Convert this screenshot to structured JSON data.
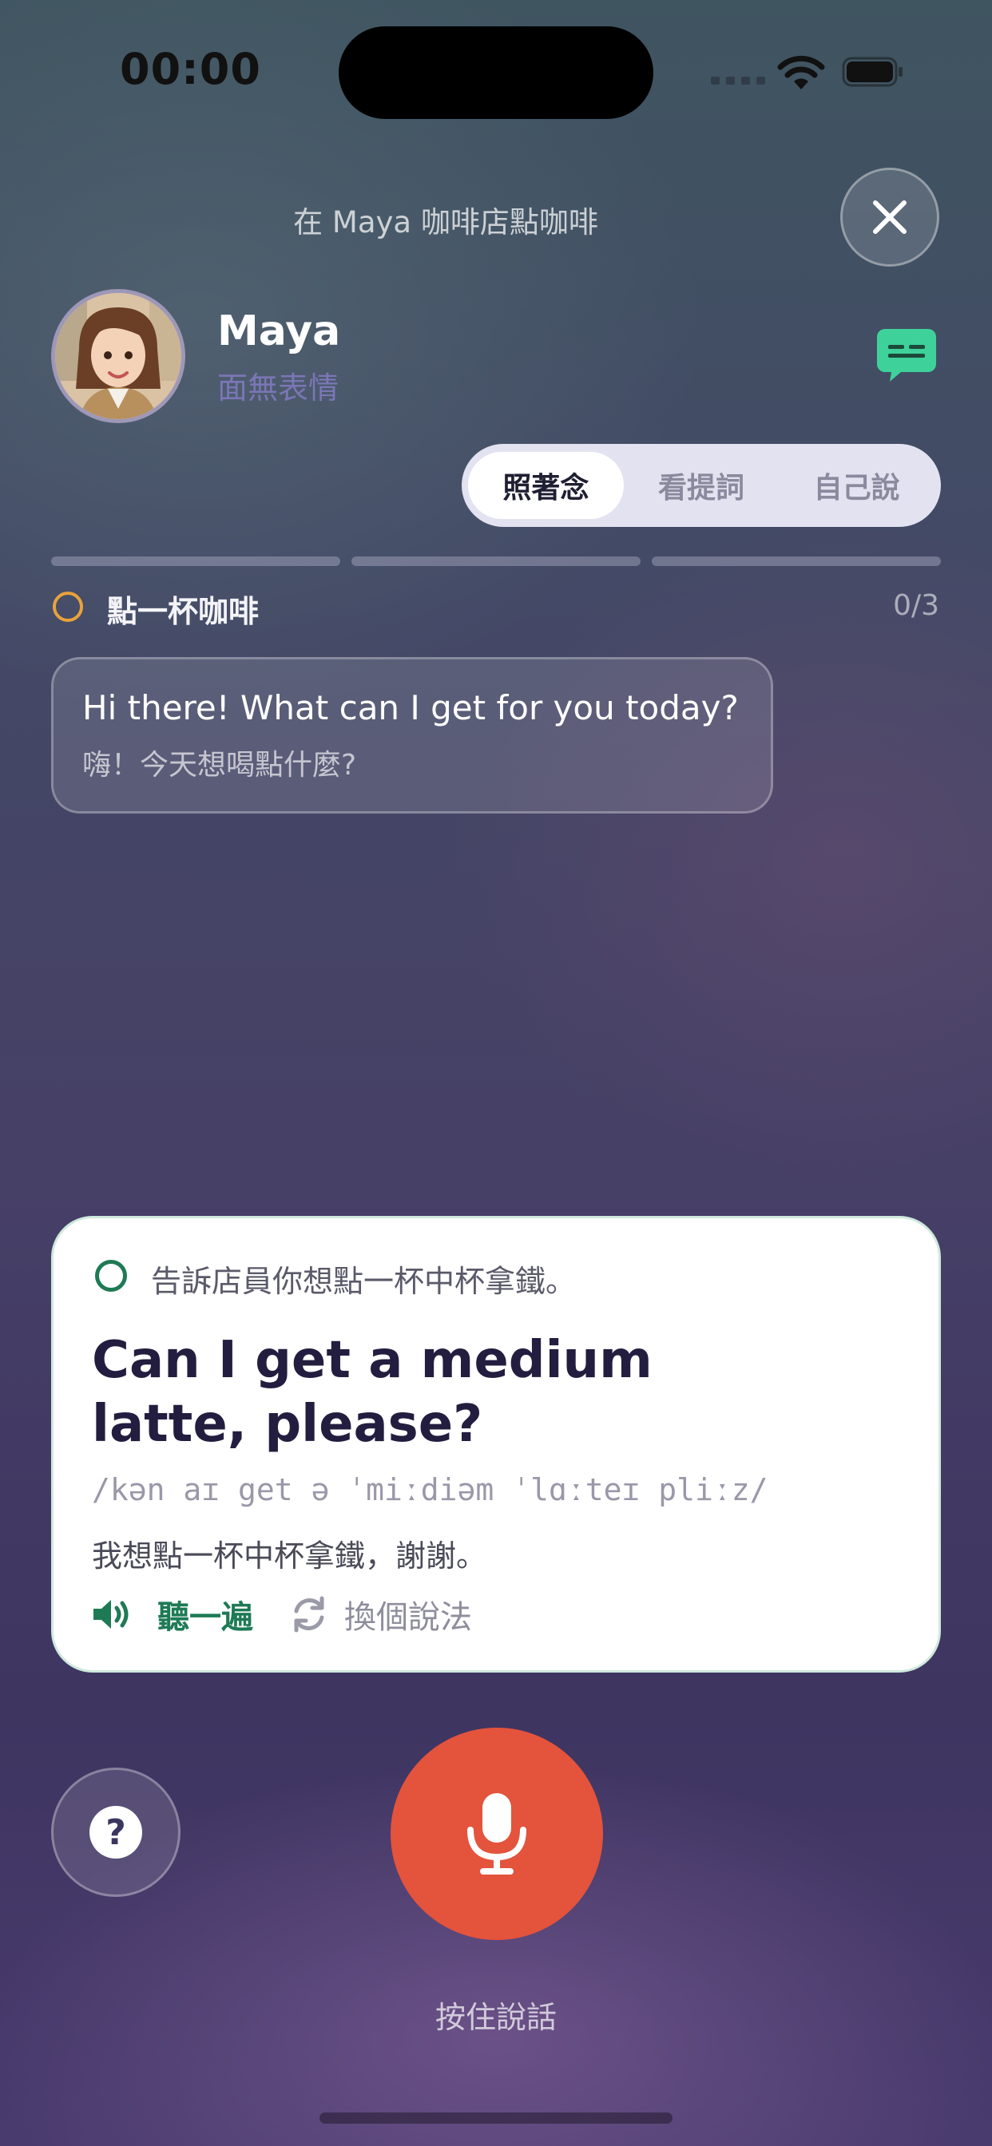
{
  "status_bar": {
    "time": "00:00"
  },
  "header": {
    "scenario_title": "在 Maya 咖啡店點咖啡",
    "close_icon": "close-icon"
  },
  "character": {
    "name": "Maya",
    "mood": "面無表情",
    "subtitle_icon": "chat-bubble-icon"
  },
  "modes": {
    "items": [
      {
        "label": "照著念",
        "active": true
      },
      {
        "label": "看提詞",
        "active": false
      },
      {
        "label": "自己說",
        "active": false
      }
    ]
  },
  "progress": {
    "segments": 3,
    "completed": 0
  },
  "task": {
    "label": "點一杯咖啡",
    "count": "0/3"
  },
  "message": {
    "en": "Hi there! What can I get for you today?",
    "zh": "嗨！今天想喝點什麼?"
  },
  "prompt_card": {
    "instruction": "告訴店員你想點一杯中杯拿鐵。",
    "sentence": "Can I get a medium latte, please?",
    "ipa": "/kən aɪ get ə ˈmiːdiəm ˈlɑːteɪ pliːz/",
    "translation": "我想點一杯中杯拿鐵，謝謝。",
    "listen_label": "聽一遍",
    "alternative_label": "換個說法"
  },
  "controls": {
    "help_symbol": "?",
    "hold_to_speak": "按住說話"
  },
  "colors": {
    "accent_green": "#1e7a55",
    "mic_red": "#e4533c",
    "task_ring": "#e9a23b",
    "mood_purple": "#7b76b6"
  }
}
